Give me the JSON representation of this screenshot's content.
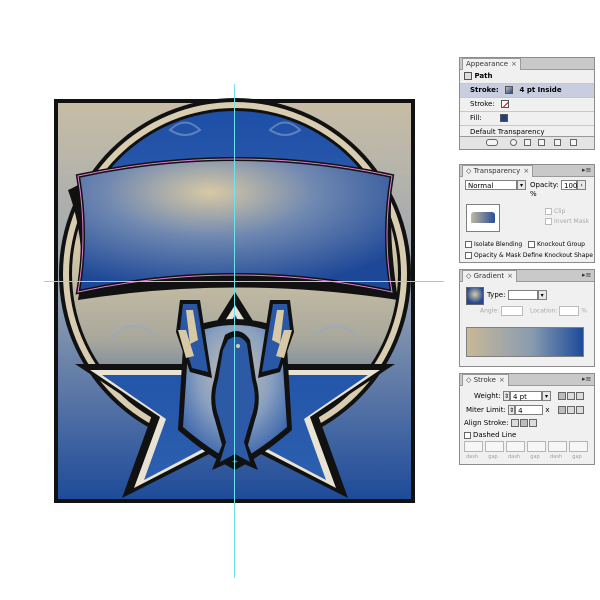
{
  "colors": {
    "guide": "#6fe3ec",
    "artwork_dark_blue": "#1d4b9a",
    "artwork_tan": "#cbbc9c",
    "selection_pink": "#e07fd2",
    "panel_bg": "#f0f0f0"
  },
  "appearance": {
    "tab_label": "Appearance",
    "object_type": "Path",
    "rows": [
      {
        "label": "Stroke:",
        "value": "4 pt Inside",
        "icon": "stroke-swatch-icon"
      },
      {
        "label": "Stroke:",
        "value": "",
        "icon": "none-swatch-icon"
      },
      {
        "label": "Fill:",
        "value": "",
        "icon": "fill-swatch-icon"
      }
    ],
    "default_transparency": "Default Transparency"
  },
  "transparency": {
    "tab_label": "Transparency",
    "blend_mode": "Normal",
    "opacity_label": "Opacity:",
    "opacity_value": "100",
    "opacity_unit": "%",
    "clip_label": "Clip",
    "invert_mask_label": "Invert Mask",
    "isolate_blending_label": "Isolate Blending",
    "knockout_group_label": "Knockout Group",
    "opacity_mask_label": "Opacity & Mask Define Knockout Shape"
  },
  "gradient": {
    "tab_label": "Gradient",
    "type_label": "Type:",
    "type_value": "",
    "angle_label": "Angle:",
    "location_label": "Location:",
    "location_unit": "%"
  },
  "stroke": {
    "tab_label": "Stroke",
    "weight_label": "Weight:",
    "weight_value": "4 pt",
    "miter_label": "Miter Limit:",
    "miter_value": "4",
    "miter_unit": "x",
    "align_label": "Align Stroke:",
    "dashed_line_label": "Dashed Line",
    "dash_labels": [
      "dash",
      "gap",
      "dash",
      "gap",
      "dash",
      "gap"
    ]
  }
}
